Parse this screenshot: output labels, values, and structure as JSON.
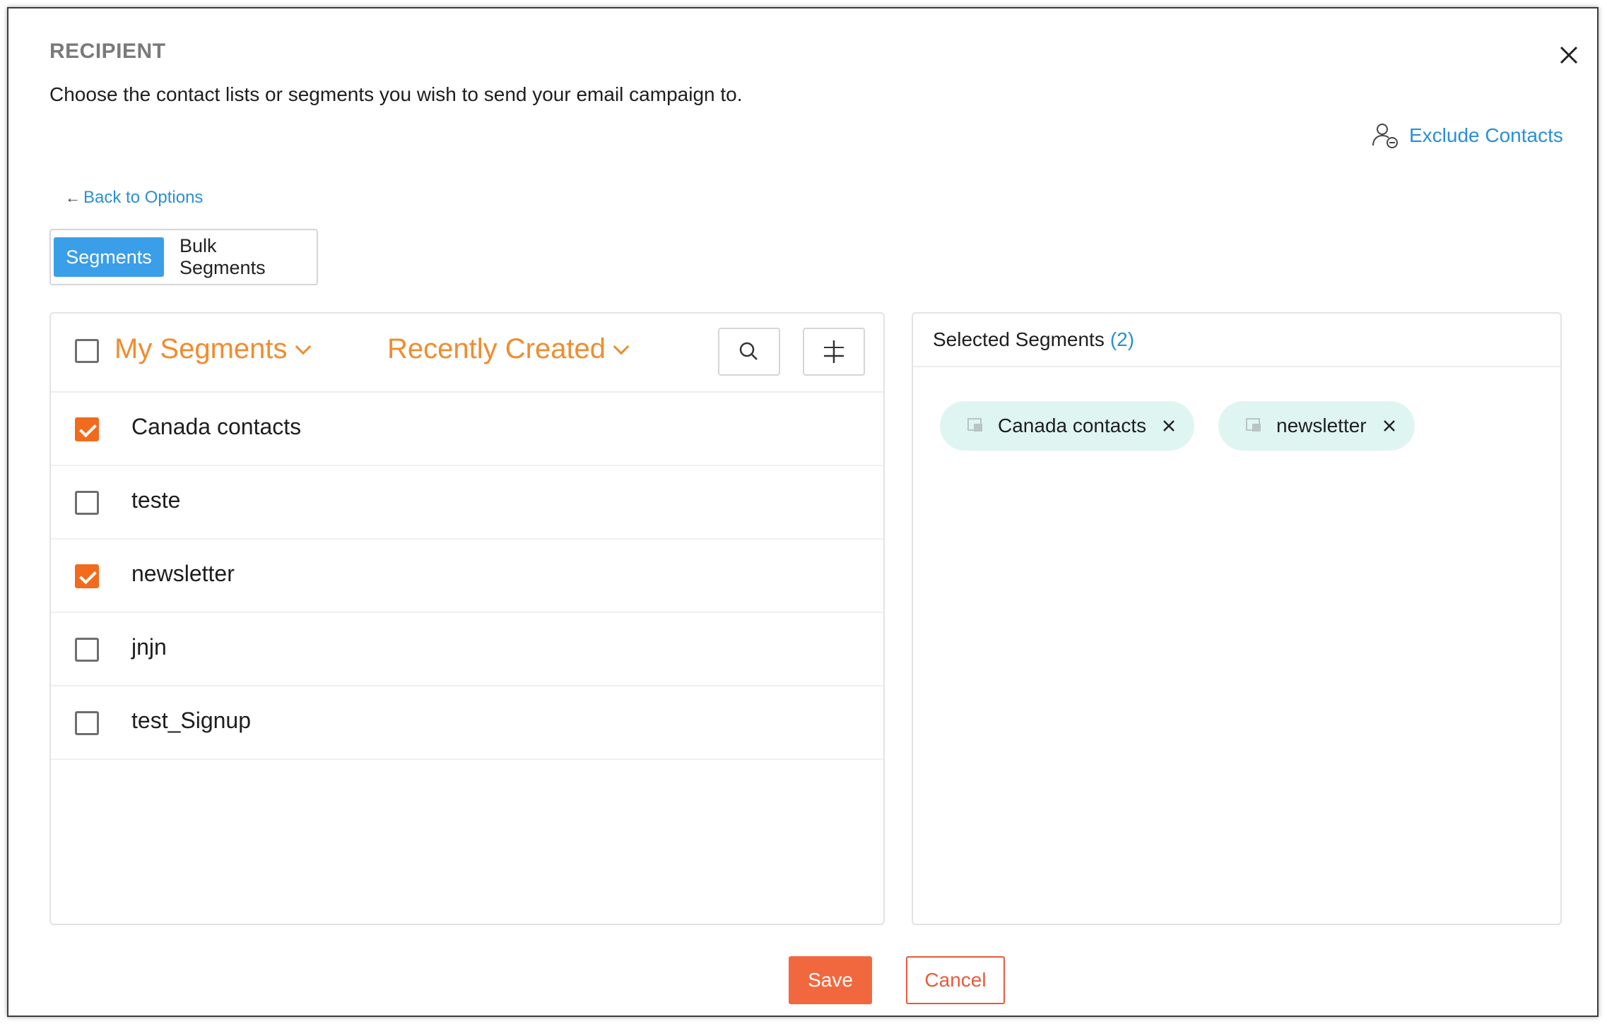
{
  "modal": {
    "title": "RECIPIENT",
    "description": "Choose the contact lists or segments you wish to send your email campaign to.",
    "exclude_label": "Exclude Contacts",
    "back_label": "Back to Options"
  },
  "tabs": [
    {
      "label": "Segments",
      "active": true
    },
    {
      "label": "Bulk Segments",
      "active": false
    }
  ],
  "left_panel": {
    "filter_label": "My Segments",
    "sort_label": "Recently Created",
    "select_all_checked": false,
    "rows": [
      {
        "label": "Canada contacts",
        "checked": true
      },
      {
        "label": "teste",
        "checked": false
      },
      {
        "label": "newsletter",
        "checked": true
      },
      {
        "label": "jnjn",
        "checked": false
      },
      {
        "label": "test_Signup",
        "checked": false
      }
    ]
  },
  "right_panel": {
    "title": "Selected Segments",
    "count": "(2)",
    "chips": [
      {
        "label": "Canada contacts"
      },
      {
        "label": "newsletter"
      }
    ]
  },
  "footer": {
    "save_label": "Save",
    "cancel_label": "Cancel"
  },
  "colors": {
    "accent_blue": "#2a8fd6",
    "tab_active": "#3a9ee8",
    "orange": "#f08c2e",
    "checkbox_orange": "#f26b1d",
    "save_button": "#f2683e",
    "chip_bg": "#dff5f1"
  }
}
